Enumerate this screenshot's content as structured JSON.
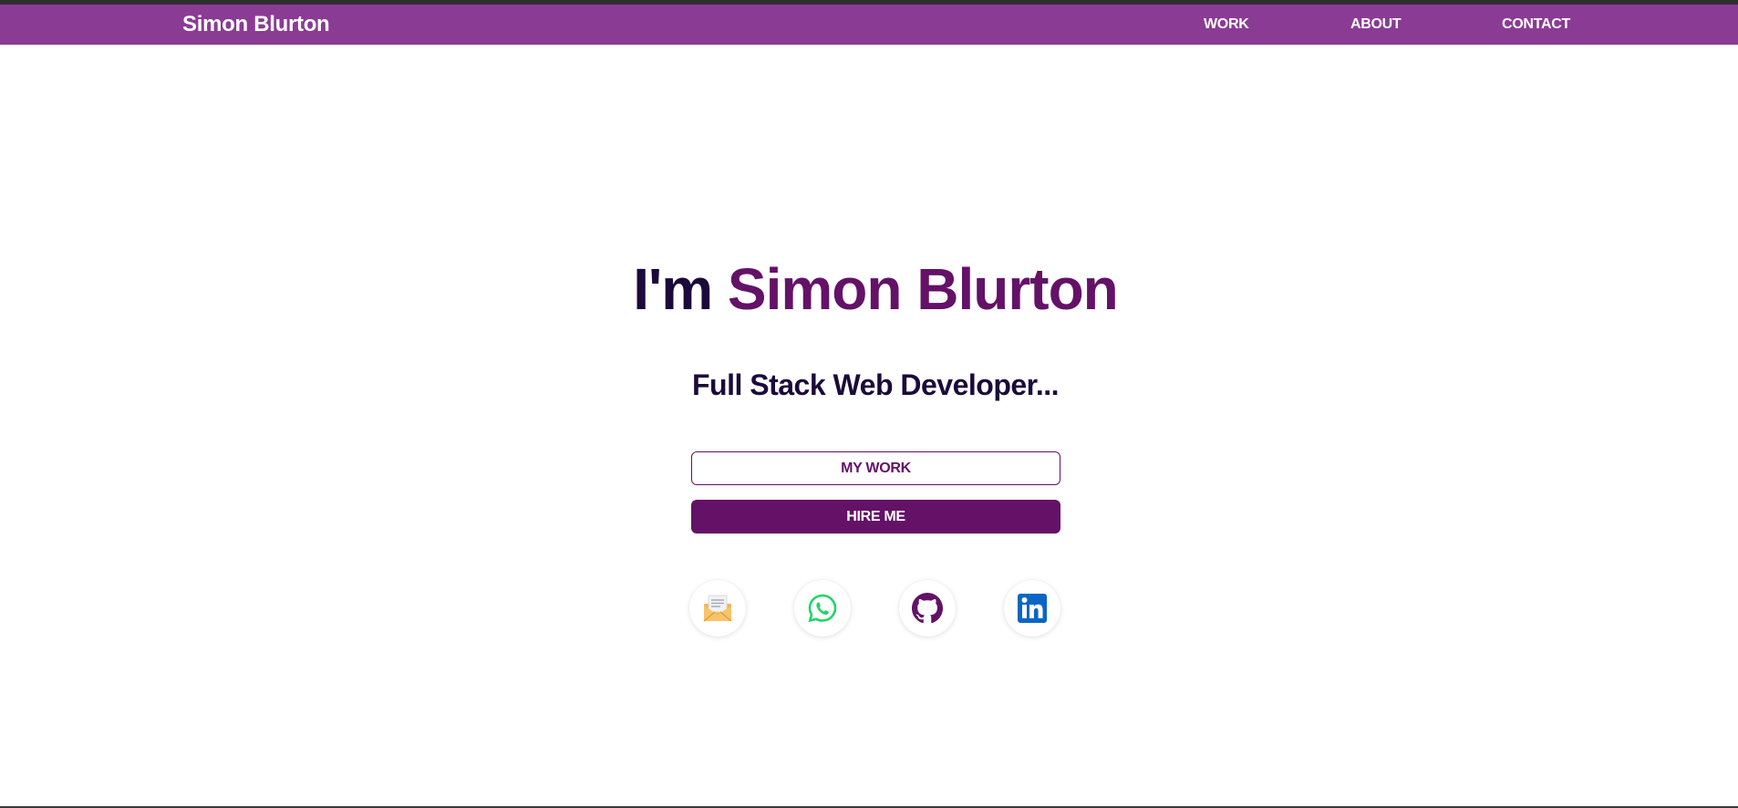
{
  "header": {
    "brand": "Simon Blurton",
    "nav": [
      {
        "label": "WORK"
      },
      {
        "label": "ABOUT"
      },
      {
        "label": "CONTACT"
      }
    ],
    "background_color": "#8a3b94"
  },
  "hero": {
    "title_prefix": "I'm",
    "title_name": "Simon Blurton",
    "subtitle": "Full Stack Web Developer...",
    "buttons": {
      "my_work": "MY WORK",
      "hire_me": "HIRE ME"
    },
    "accent_color": "#641168",
    "text_color": "#1b0a3a"
  },
  "social_links": [
    {
      "icon": "email-envelope-icon"
    },
    {
      "icon": "whatsapp-icon"
    },
    {
      "icon": "github-icon"
    },
    {
      "icon": "linkedin-icon"
    }
  ]
}
